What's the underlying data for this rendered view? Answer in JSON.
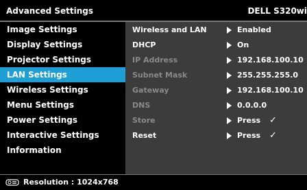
{
  "header": {
    "title": "Advanced Settings",
    "model": "DELL S320wi"
  },
  "sidebar": {
    "items": [
      {
        "label": "Image Settings",
        "active": false
      },
      {
        "label": "Display Settings",
        "active": false
      },
      {
        "label": "Projector Settings",
        "active": false
      },
      {
        "label": "LAN Settings",
        "active": true
      },
      {
        "label": "Wireless Settings",
        "active": false
      },
      {
        "label": "Menu Settings",
        "active": false
      },
      {
        "label": "Power Settings",
        "active": false
      },
      {
        "label": "Interactive Settings",
        "active": false
      },
      {
        "label": "Information",
        "active": false
      }
    ]
  },
  "panel": {
    "rows": [
      {
        "label": "Wireless and LAN",
        "value": "Enabled",
        "enabled": true
      },
      {
        "label": "DHCP",
        "value": "On",
        "enabled": true
      },
      {
        "label": "IP Address",
        "value": "192.168.100.10",
        "enabled": false
      },
      {
        "label": "Subnet Mask",
        "value": "255.255.255.0",
        "enabled": false
      },
      {
        "label": "Gateway",
        "value": "192.168.100.10",
        "enabled": false
      },
      {
        "label": "DNS",
        "value": "0.0.0.0",
        "enabled": false
      },
      {
        "label": "Store",
        "value": "Press",
        "check": "✓",
        "enabled": false
      },
      {
        "label": "Reset",
        "value": "Press",
        "check": "✓",
        "enabled": true
      }
    ]
  },
  "footer": {
    "icon": "projector-resolution-icon",
    "resolution_label": "Resolution : 1024x768"
  },
  "colors": {
    "accent": "#1e9fd6",
    "panel_bg": "#3c3c3c",
    "disabled_text": "#8a8a8a"
  }
}
